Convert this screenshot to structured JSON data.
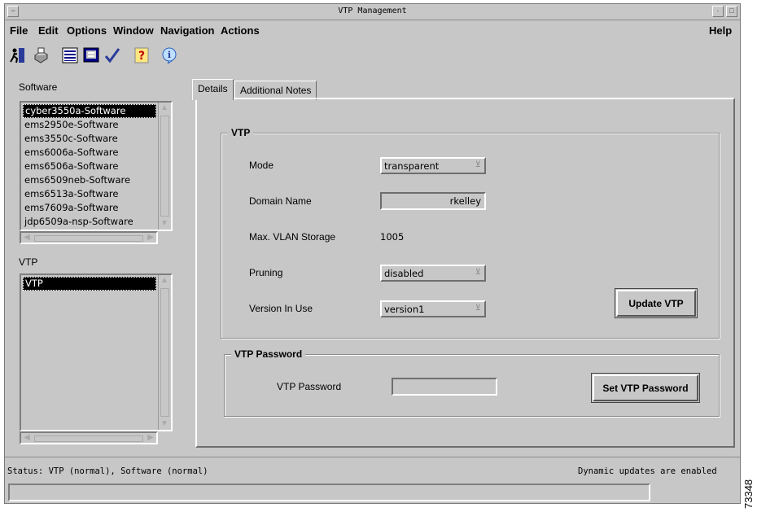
{
  "window": {
    "title": "VTP Management",
    "side_id": "73348"
  },
  "menu": {
    "file": "File",
    "edit": "Edit",
    "options": "Options",
    "window": "Window",
    "navigation": "Navigation",
    "actions": "Actions",
    "help": "Help"
  },
  "toolbar": {
    "icons": [
      "exit-icon",
      "print-icon",
      "list-icon",
      "monitor-icon",
      "check-icon",
      "help-icon",
      "info-icon"
    ]
  },
  "software": {
    "label": "Software",
    "items": [
      "cyber3550a-Software",
      "ems2950e-Software",
      "ems3550c-Software",
      "ems6006a-Software",
      "ems6506a-Software",
      "ems6509neb-Software",
      "ems6513a-Software",
      "ems7609a-Software",
      "jdp6509a-nsp-Software"
    ],
    "selected": "cyber3550a-Software"
  },
  "vtp_list": {
    "label": "VTP",
    "items": [
      "VTP"
    ]
  },
  "tabs": {
    "details": "Details",
    "notes": "Additional Notes"
  },
  "vtp_group": {
    "title": "VTP",
    "mode_label": "Mode",
    "mode_value": "transparent",
    "domain_label": "Domain Name",
    "domain_value": "rkelley",
    "storage_label": "Max. VLAN Storage",
    "storage_value": "1005",
    "pruning_label": "Pruning",
    "pruning_value": "disabled",
    "version_label": "Version In Use",
    "version_value": "version1",
    "update_button": "Update VTP"
  },
  "password_group": {
    "title": "VTP Password",
    "password_label": "VTP Password",
    "password_value": "",
    "set_button": "Set VTP Password"
  },
  "status": {
    "text": "Status: VTP (normal), Software (normal)",
    "updates": "Dynamic updates are enabled"
  }
}
